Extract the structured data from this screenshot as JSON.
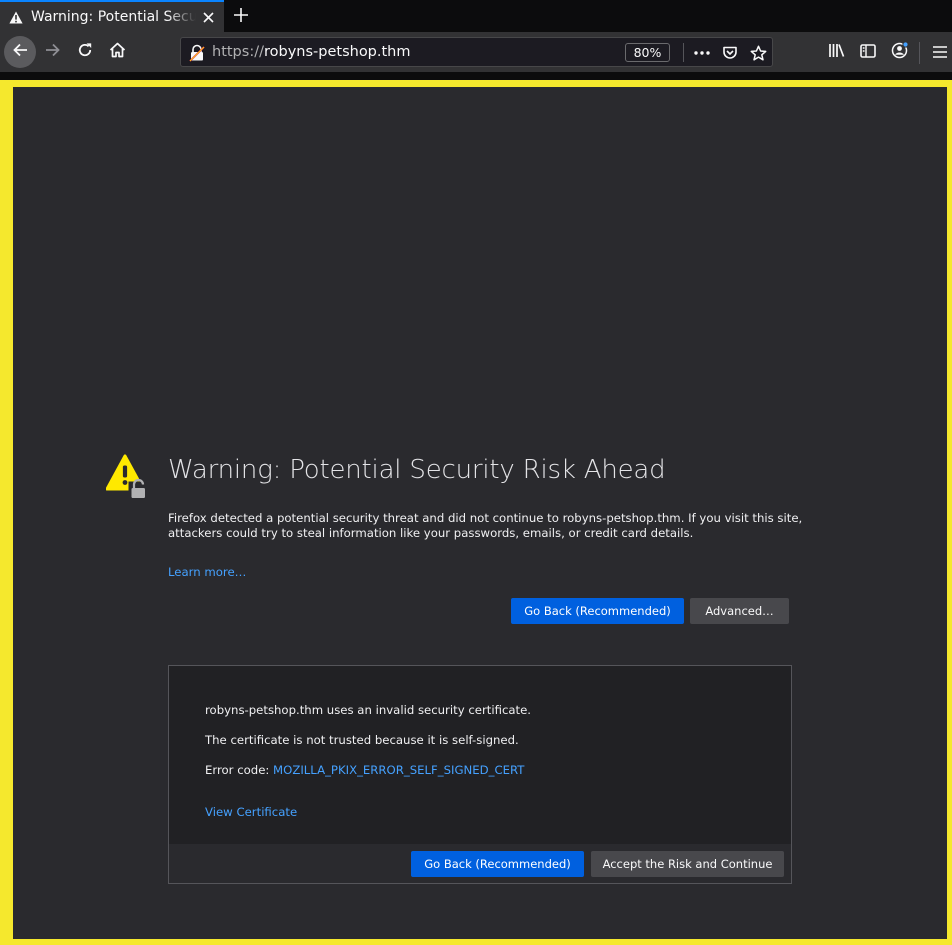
{
  "tab": {
    "title": "Warning: Potential Security Risk Ahead"
  },
  "url": {
    "scheme": "https://",
    "host": "robyns-petshop.thm"
  },
  "zoom": "80%",
  "page": {
    "title": "Warning: Potential Security Risk Ahead",
    "description": "Firefox detected a potential security threat and did not continue to robyns-petshop.thm. If you visit this site, attackers could try to steal information like your passwords, emails, or credit card details.",
    "learn_more": "Learn more…",
    "go_back": "Go Back (Recommended)",
    "advanced": "Advanced…"
  },
  "advanced_panel": {
    "invalid_cert": "robyns-petshop.thm uses an invalid security certificate.",
    "not_trusted": "The certificate is not trusted because it is self-signed.",
    "error_code_label": "Error code: ",
    "error_code": "MOZILLA_PKIX_ERROR_SELF_SIGNED_CERT",
    "view_certificate": "View Certificate",
    "go_back": "Go Back (Recommended)",
    "accept": "Accept the Risk and Continue"
  },
  "icons": {
    "tab_warning": "warning-icon",
    "close": "close-icon",
    "new_tab": "plus-icon",
    "back": "arrow-left-icon",
    "forward": "arrow-right-icon",
    "reload": "reload-icon",
    "home": "home-icon",
    "insecure_lock": "insecure-lock-icon",
    "page_actions": "ellipsis-icon",
    "pocket": "pocket-icon",
    "bookmark": "star-icon",
    "library": "library-icon",
    "sidebar": "sidebar-icon",
    "account": "account-icon",
    "menu": "hamburger-menu-icon"
  },
  "colors": {
    "content_border": "#f5e82d",
    "page_background": "#2a2a2e",
    "primary_button": "#0060df",
    "link": "#45a1ff",
    "warning_yellow": "#ffe900"
  }
}
